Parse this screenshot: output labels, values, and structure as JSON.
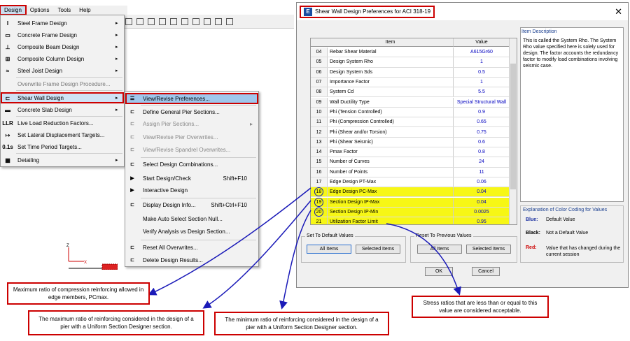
{
  "menubar": [
    "Design",
    "Options",
    "Tools",
    "Help"
  ],
  "design_menu": [
    {
      "icon": "I",
      "label": "Steel Frame Design",
      "arrow": "▸",
      "dis": false,
      "hl": false
    },
    {
      "icon": "▭",
      "label": "Concrete Frame Design",
      "arrow": "▸",
      "dis": false,
      "hl": false
    },
    {
      "icon": "⊥",
      "label": "Composite Beam Design",
      "arrow": "▸",
      "dis": false,
      "hl": false
    },
    {
      "icon": "⊞",
      "label": "Composite Column Design",
      "arrow": "▸",
      "dis": false,
      "hl": false
    },
    {
      "icon": "≈",
      "label": "Steel Joist Design",
      "arrow": "▸",
      "dis": false,
      "hl": false
    },
    {
      "icon": "",
      "label": "Overwrite Frame Design Procedure...",
      "arrow": "",
      "dis": true,
      "hl": false
    },
    {
      "icon": "⊏",
      "label": "Shear Wall Design",
      "arrow": "▸",
      "dis": false,
      "hl": true
    },
    {
      "icon": "▬",
      "label": "Concrete Slab Design",
      "arrow": "▸",
      "dis": false,
      "hl": false
    },
    {
      "icon": "LLR",
      "label": "Live Load Reduction Factors...",
      "arrow": "",
      "dis": false,
      "hl": false
    },
    {
      "icon": "↦",
      "label": "Set Lateral Displacement Targets...",
      "arrow": "",
      "dis": false,
      "hl": false
    },
    {
      "icon": "0.1s",
      "label": "Set Time Period Targets...",
      "arrow": "",
      "dis": false,
      "hl": false
    },
    {
      "icon": "▦",
      "label": "Detailing",
      "arrow": "▸",
      "dis": false,
      "hl": false
    }
  ],
  "shear_wall_submenu": [
    {
      "label": "View/Revise Preferences...",
      "shortcut": "",
      "dis": false,
      "hl": true,
      "arrow": ""
    },
    {
      "label": "Define General Pier Sections...",
      "shortcut": "",
      "dis": false,
      "hl": false,
      "arrow": ""
    },
    {
      "label": "Assign Pier Sections...",
      "shortcut": "",
      "dis": true,
      "hl": false,
      "arrow": "▸"
    },
    {
      "label": "View/Revise Pier Overwrites...",
      "shortcut": "",
      "dis": true,
      "hl": false,
      "arrow": ""
    },
    {
      "label": "View/Revise Spandrel Overwrites...",
      "shortcut": "",
      "dis": true,
      "hl": false,
      "arrow": ""
    },
    {
      "label": "Select Design Combinations...",
      "shortcut": "",
      "dis": false,
      "hl": false,
      "arrow": ""
    },
    {
      "label": "Start Design/Check",
      "shortcut": "Shift+F10",
      "dis": false,
      "hl": false,
      "arrow": ""
    },
    {
      "label": "Interactive Design",
      "shortcut": "",
      "dis": false,
      "hl": false,
      "arrow": ""
    },
    {
      "label": "Display Design Info...",
      "shortcut": "Shift+Ctrl+F10",
      "dis": false,
      "hl": false,
      "arrow": ""
    },
    {
      "label": "Make Auto Select Section Null...",
      "shortcut": "",
      "dis": false,
      "hl": false,
      "arrow": ""
    },
    {
      "label": "Verify Analysis vs Design Section...",
      "shortcut": "",
      "dis": false,
      "hl": false,
      "arrow": ""
    },
    {
      "label": "Reset All Overwrites...",
      "shortcut": "",
      "dis": false,
      "hl": false,
      "arrow": ""
    },
    {
      "label": "Delete Design Results...",
      "shortcut": "",
      "dis": false,
      "hl": false,
      "arrow": ""
    }
  ],
  "dialog": {
    "title": "Shear Wall Design Preferences for ACI 318-19",
    "close": "✕",
    "col_item": "Item",
    "col_value": "Value",
    "rows": [
      {
        "n": "04",
        "item": "Rebar Shear Material",
        "value": "A615Gr60",
        "hl": false
      },
      {
        "n": "05",
        "item": "Design System Rho",
        "value": "1",
        "hl": false
      },
      {
        "n": "06",
        "item": "Design System Sds",
        "value": "0.5",
        "hl": false
      },
      {
        "n": "07",
        "item": "Importance Factor",
        "value": "1",
        "hl": false
      },
      {
        "n": "08",
        "item": "System Cd",
        "value": "5.5",
        "hl": false
      },
      {
        "n": "09",
        "item": "Wall Ductility Type",
        "value": "Special Structural Wall",
        "hl": false
      },
      {
        "n": "10",
        "item": "Phi (Tension Controlled)",
        "value": "0.9",
        "hl": false
      },
      {
        "n": "11",
        "item": "Phi (Compression Controlled)",
        "value": "0.65",
        "hl": false
      },
      {
        "n": "12",
        "item": "Phi (Shear and/or Torsion)",
        "value": "0.75",
        "hl": false
      },
      {
        "n": "13",
        "item": "Phi (Shear Seismic)",
        "value": "0.6",
        "hl": false
      },
      {
        "n": "14",
        "item": "Pmax Factor",
        "value": "0.8",
        "hl": false
      },
      {
        "n": "15",
        "item": "Number of Curves",
        "value": "24",
        "hl": false
      },
      {
        "n": "16",
        "item": "Number of Points",
        "value": "11",
        "hl": false
      },
      {
        "n": "17",
        "item": "Edge Design PT-Max",
        "value": "0.06",
        "hl": false
      },
      {
        "n": "18",
        "item": "Edge Design PC-Max",
        "value": "0.04",
        "hl": true
      },
      {
        "n": "19",
        "item": "Section Design IP-Max",
        "value": "0.04",
        "hl": true
      },
      {
        "n": "20",
        "item": "Section Design IP-Min",
        "value": "0.0025",
        "hl": true
      },
      {
        "n": "21",
        "item": "Utilization Factor Limit",
        "value": "0.95",
        "hl": true
      }
    ],
    "help_header": "Item Description",
    "help_text": "This is called the System Rho. The System Rho value specified here is solely used for design. The factor accounts the redundancy factor to modify load combinations involving seismic case.",
    "legend_header": "Explanation of Color Coding for Values",
    "legend": [
      {
        "key": "Blue:",
        "text": "Default Value",
        "color": "#1a2fa0"
      },
      {
        "key": "Black:",
        "text": "Not a Default Value",
        "color": "#000000"
      },
      {
        "key": "Red:",
        "text": "Value that has changed during the current session",
        "color": "#cc0000"
      }
    ],
    "set_default_label": "Set To Default Values",
    "reset_prev_label": "Reset To Previous Values",
    "all_items": "All Items",
    "selected_items": "Selected Items",
    "ok": "OK",
    "cancel": "Cancel"
  },
  "axis": {
    "z": "Z",
    "x": "X"
  },
  "callouts": {
    "pcmax": "Maximum ratio of compression reinforcing  allowed in edge members, PCmax.",
    "ipmax": "The maximum ratio of reinforcing considered in the design of a pier with a Uniform Section Designer section.",
    "ipmin": "The minimum ratio of reinforcing considered in the design of a pier with a Uniform Section Designer section.",
    "ufl": "Stress ratios that are less than or equal to this value are considered acceptable."
  },
  "colors": {
    "highlight": "#f7f715",
    "accent_red": "#cc0000",
    "arrow_blue": "#1a1ab8"
  }
}
